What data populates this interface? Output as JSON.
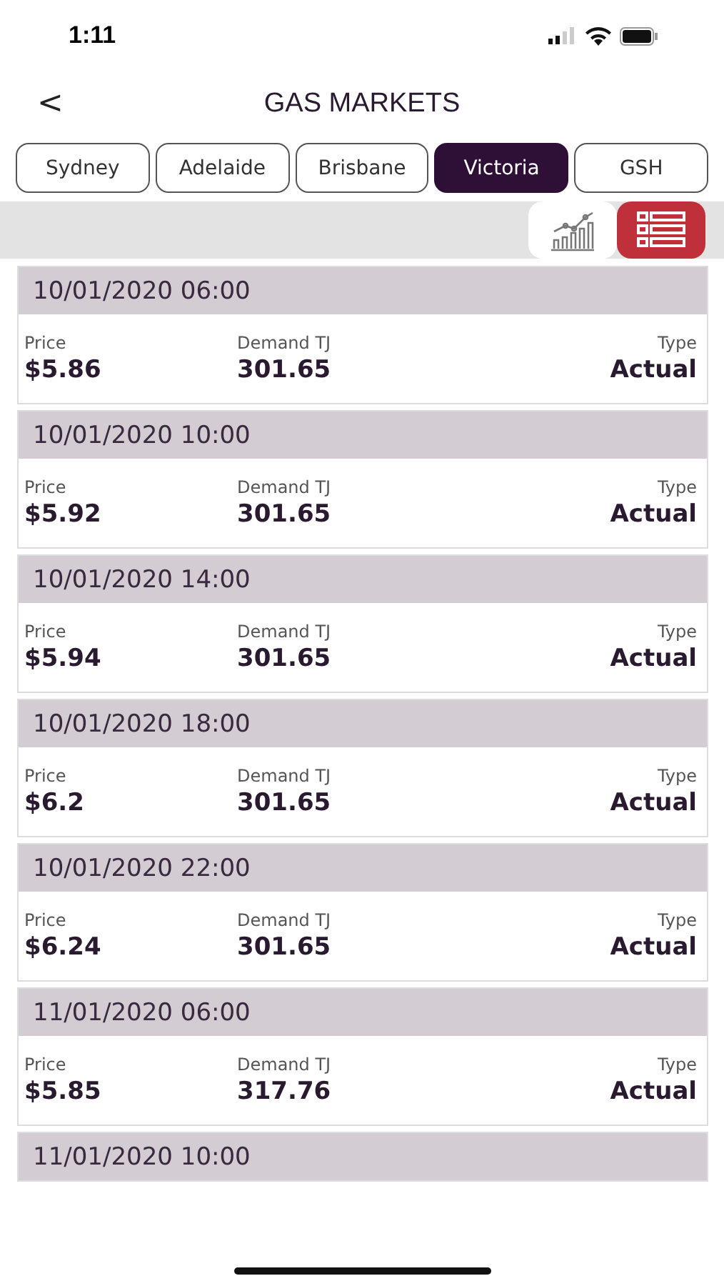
{
  "status_bar": {
    "time": "1:11"
  },
  "header": {
    "back": "<",
    "title": "GAS MARKETS"
  },
  "tabs": [
    {
      "label": "Sydney",
      "selected": false
    },
    {
      "label": "Adelaide",
      "selected": false
    },
    {
      "label": "Brisbane",
      "selected": false
    },
    {
      "label": "Victoria",
      "selected": true
    },
    {
      "label": "GSH",
      "selected": false
    }
  ],
  "view_toggle": [
    {
      "kind": "chart",
      "selected": false
    },
    {
      "kind": "list",
      "selected": true
    }
  ],
  "records": [
    {
      "datetime": "10/01/2020 06:00",
      "price_label": "Price",
      "price": "$5.86",
      "demand_label": "Demand TJ",
      "demand": "301.65",
      "type_label": "Type",
      "type": "Actual"
    },
    {
      "datetime": "10/01/2020 10:00",
      "price_label": "Price",
      "price": "$5.92",
      "demand_label": "Demand TJ",
      "demand": "301.65",
      "type_label": "Type",
      "type": "Actual"
    },
    {
      "datetime": "10/01/2020 14:00",
      "price_label": "Price",
      "price": "$5.94",
      "demand_label": "Demand TJ",
      "demand": "301.65",
      "type_label": "Type",
      "type": "Actual"
    },
    {
      "datetime": "10/01/2020 18:00",
      "price_label": "Price",
      "price": "$6.2",
      "demand_label": "Demand TJ",
      "demand": "301.65",
      "type_label": "Type",
      "type": "Actual"
    },
    {
      "datetime": "10/01/2020 22:00",
      "price_label": "Price",
      "price": "$6.24",
      "demand_label": "Demand TJ",
      "demand": "301.65",
      "type_label": "Type",
      "type": "Actual"
    },
    {
      "datetime": "11/01/2020 06:00",
      "price_label": "Price",
      "price": "$5.85",
      "demand_label": "Demand TJ",
      "demand": "317.76",
      "type_label": "Type",
      "type": "Actual"
    },
    {
      "datetime": "11/01/2020 10:00"
    }
  ]
}
